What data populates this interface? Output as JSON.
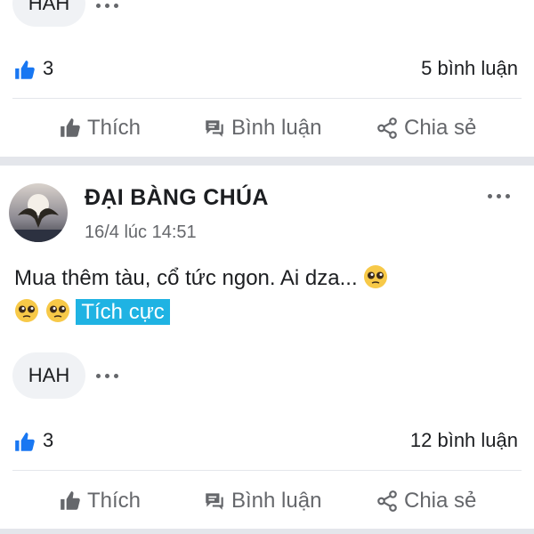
{
  "post_prev": {
    "tag": "HAH",
    "likes": "3",
    "comments": "5 bình luận"
  },
  "actions": {
    "like": "Thích",
    "comment": "Bình luận",
    "share": "Chia sẻ"
  },
  "post": {
    "author": "ĐẠI BÀNG CHÚA",
    "timestamp": "16/4 lúc 14:51",
    "text": "Mua thêm tàu, cổ tức ngon. Ai dza...",
    "sentiment_label": "Tích cực",
    "tag": "HAH",
    "likes": "3",
    "comments": "12 bình luận"
  },
  "colors": {
    "accent_blue": "#1877f2",
    "highlight": "#1fb3e3",
    "muted": "#65676b"
  },
  "icons": [
    "like-icon",
    "comment-icon",
    "share-icon",
    "more-icon",
    "pleading-face-emoji"
  ]
}
